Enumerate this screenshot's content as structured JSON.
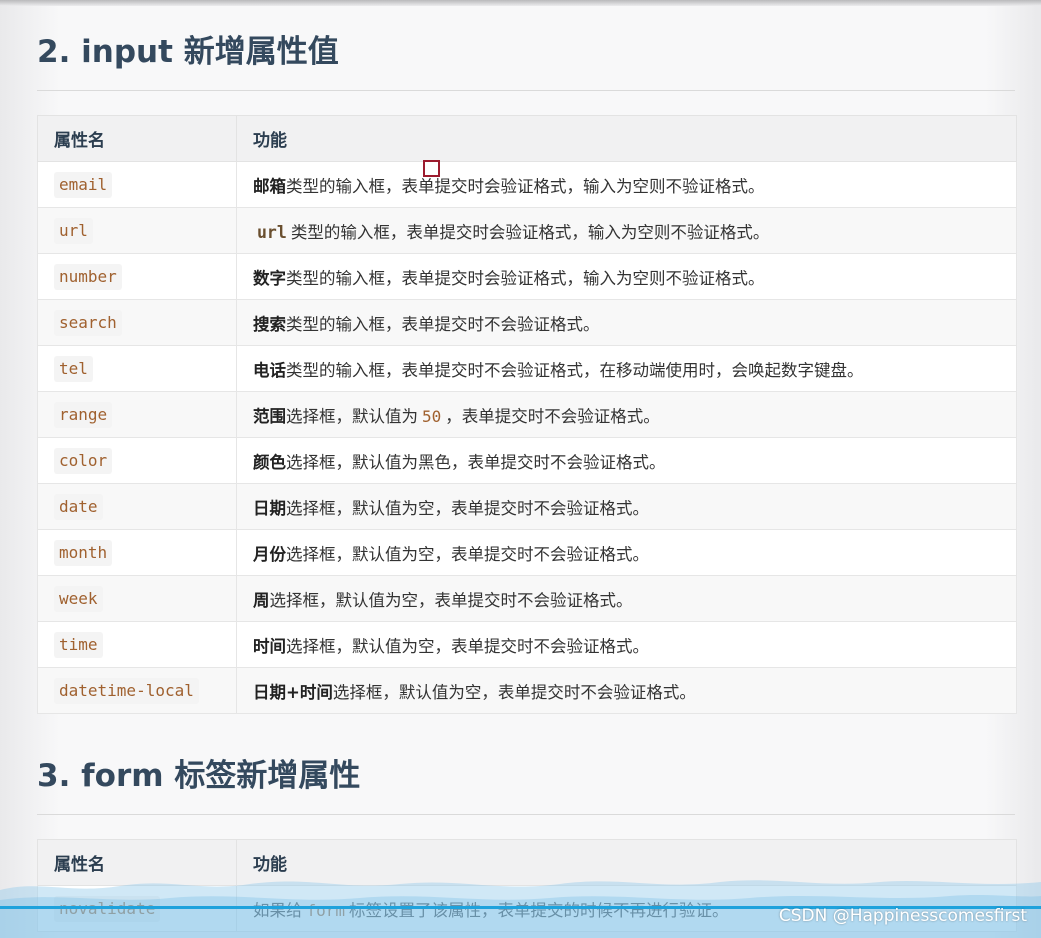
{
  "section2": {
    "number": "2.",
    "title": "input 新增属性值",
    "headers": [
      "属性名",
      "功能"
    ],
    "rows": [
      {
        "name": "email",
        "bold": "邮箱",
        "text": "类型的输入框，表单提交时会验证格式，输入为空则不验证格式。"
      },
      {
        "name": "url",
        "bold_code": "url",
        "text": "类型的输入框，表单提交时会验证格式，输入为空则不验证格式。"
      },
      {
        "name": "number",
        "bold": "数字",
        "text": "类型的输入框，表单提交时会验证格式，输入为空则不验证格式。"
      },
      {
        "name": "search",
        "bold": "搜索",
        "text": "类型的输入框，表单提交时不会验证格式。"
      },
      {
        "name": "tel",
        "bold": "电话",
        "text": "类型的输入框，表单提交时不会验证格式，在移动端使用时，会唤起数字键盘。"
      },
      {
        "name": "range",
        "bold": "范围",
        "text_before": "选择框，默认值为",
        "code": "50",
        "text": "，表单提交时不会验证格式。"
      },
      {
        "name": "color",
        "bold": "颜色",
        "text": "选择框，默认值为黑色，表单提交时不会验证格式。"
      },
      {
        "name": "date",
        "bold": "日期",
        "text": "选择框，默认值为空，表单提交时不会验证格式。"
      },
      {
        "name": "month",
        "bold": "月份",
        "text": "选择框，默认值为空，表单提交时不会验证格式。"
      },
      {
        "name": "week",
        "bold": "周",
        "text": "选择框，默认值为空，表单提交时不会验证格式。"
      },
      {
        "name": "time",
        "bold": "时间",
        "text": "选择框，默认值为空，表单提交时不会验证格式。"
      },
      {
        "name": "datetime-local",
        "bold": "日期+时间",
        "text": "选择框，默认值为空，表单提交时不会验证格式。"
      }
    ]
  },
  "section3": {
    "number": "3.",
    "title": "form 标签新增属性",
    "headers": [
      "属性名",
      "功能"
    ],
    "rows": [
      {
        "name": "novalidate",
        "text_before": "如果给",
        "code": "form",
        "text": "标签设置了该属性，表单提交的时候不再进行验证。"
      }
    ]
  },
  "watermark": "CSDN @Happinesscomesfirst",
  "colors": {
    "heading": "#34495e",
    "code": "#a0612f",
    "cursor": "#9c1b2e",
    "wave": "#5ab8e0"
  }
}
